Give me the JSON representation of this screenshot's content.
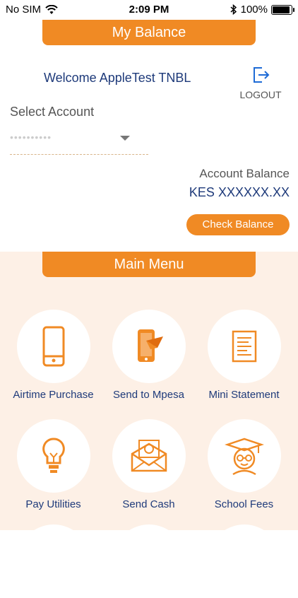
{
  "status_bar": {
    "carrier": "No SIM",
    "time": "2:09 PM",
    "battery": "100%"
  },
  "balance": {
    "title": "My Balance",
    "welcome": "Welcome AppleTest TNBL",
    "logout_label": "LOGOUT",
    "select_label": "Select Account",
    "account_value": "••••••••••",
    "balance_label": "Account Balance",
    "balance_value": "KES XXXXXX.XX",
    "check_label": "Check Balance"
  },
  "menu": {
    "title": "Main Menu",
    "items": [
      {
        "label": "Airtime Purchase",
        "icon": "mobile-phone-icon"
      },
      {
        "label": "Send to Mpesa",
        "icon": "send-to-mpesa-icon"
      },
      {
        "label": "Mini Statement",
        "icon": "statement-icon"
      },
      {
        "label": "Pay Utilities",
        "icon": "light-bulb-icon"
      },
      {
        "label": "Send Cash",
        "icon": "cash-envelope-icon"
      },
      {
        "label": "School Fees",
        "icon": "graduate-icon"
      }
    ]
  },
  "colors": {
    "accent": "#f08a24",
    "text_blue": "#1e3a7a",
    "menu_bg": "#fdf0e6"
  }
}
